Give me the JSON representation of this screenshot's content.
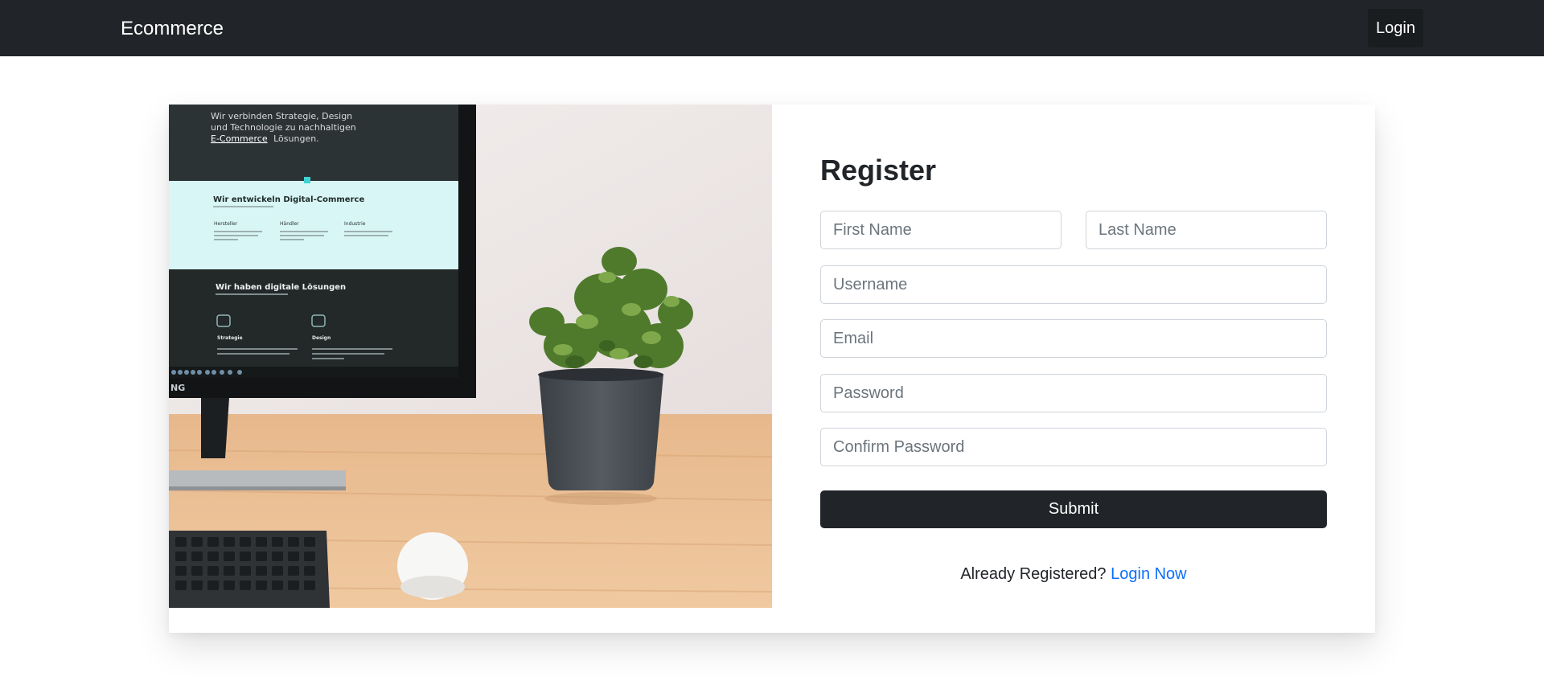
{
  "navbar": {
    "brand": "Ecommerce",
    "login_label": "Login"
  },
  "illustration": {
    "screen_text_1": "Wir verbinden Strategie, Design",
    "screen_text_2": "und Technologie zu nachhaltigen",
    "screen_text_3_emph": "E-Commerce",
    "screen_text_3_rest": "Lösungen.",
    "screen_heading": "Wir entwickeln Digital-Commerce",
    "screen_col_1": "Hersteller",
    "screen_col_2": "Händler",
    "screen_col_3": "Industrie",
    "screen_heading_2": "Wir haben digitale Lösungen",
    "screen_tile_1": "Strategie",
    "screen_tile_2": "Design",
    "monitor_edge_text": "NG"
  },
  "form": {
    "title": "Register",
    "first_name_placeholder": "First Name",
    "last_name_placeholder": "Last Name",
    "username_placeholder": "Username",
    "email_placeholder": "Email",
    "password_placeholder": "Password",
    "confirm_password_placeholder": "Confirm Password",
    "submit_label": "Submit",
    "already_registered": "Already Registered?",
    "login_now_label": "Login Now"
  },
  "colors": {
    "navbar_bg": "#212529",
    "link": "#0d6efd",
    "button_bg": "#212529"
  }
}
